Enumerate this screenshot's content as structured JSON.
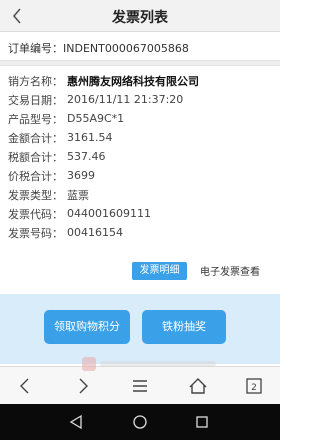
{
  "header": {
    "title": "发票列表"
  },
  "order": {
    "label": "订单编号：",
    "value": "INDENT000067005868"
  },
  "details": [
    {
      "label": "销方名称：",
      "value": "惠州腾友网络科技有限公司",
      "bold": true
    },
    {
      "label": "交易日期：",
      "value": "2016/11/11 21:37:20"
    },
    {
      "label": "产品型号：",
      "value": "D55A9C*1"
    },
    {
      "label": "金额合计：",
      "value": "3161.54"
    },
    {
      "label": "税额合计：",
      "value": "537.46"
    },
    {
      "label": "价税合计：",
      "value": "3699"
    },
    {
      "label": "发票类型：",
      "value": "蓝票"
    },
    {
      "label": "发票代码：",
      "value": "044001609111"
    },
    {
      "label": "发票号码：",
      "value": "00416154"
    }
  ],
  "actions": {
    "detail_button": "发票明细",
    "e_invoice_link": "电子发票查看",
    "points_button": "领取购物积分",
    "lottery_button": "铁粉抽奖"
  },
  "browser": {
    "tab_count": "2"
  },
  "icons": {
    "back": "chevron-left-icon",
    "nav_back": "arrow-left-icon",
    "nav_forward": "arrow-right-icon",
    "menu": "menu-icon",
    "home": "home-icon",
    "tabs": "tabs-icon",
    "sys_back": "triangle-back-icon",
    "sys_home": "circle-home-icon",
    "sys_recent": "square-recent-icon"
  },
  "colors": {
    "accent": "#3aa0e8",
    "action_band": "#d9ecfa",
    "system_bar": "#0a0a0a"
  }
}
